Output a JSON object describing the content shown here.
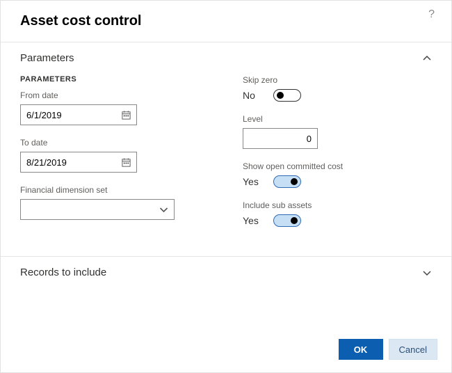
{
  "dialog": {
    "title": "Asset cost control",
    "help_icon": "help-icon"
  },
  "sections": {
    "parameters": {
      "title": "Parameters",
      "expanded": true
    },
    "records": {
      "title": "Records to include",
      "expanded": false
    }
  },
  "parameters": {
    "subhead": "PARAMETERS",
    "from_date": {
      "label": "From date",
      "value": "6/1/2019"
    },
    "to_date": {
      "label": "To date",
      "value": "8/21/2019"
    },
    "fin_dim": {
      "label": "Financial dimension set",
      "value": ""
    },
    "skip_zero": {
      "label": "Skip zero",
      "value_text": "No",
      "on": false
    },
    "level": {
      "label": "Level",
      "value": "0"
    },
    "show_open_committed": {
      "label": "Show open committed cost",
      "value_text": "Yes",
      "on": true
    },
    "include_sub_assets": {
      "label": "Include sub assets",
      "value_text": "Yes",
      "on": true
    }
  },
  "buttons": {
    "ok": "OK",
    "cancel": "Cancel"
  },
  "colors": {
    "primary": "#0b5eb0",
    "secondary_bg": "#dbe8f4",
    "toggle_on_bg": "#c7dff5"
  }
}
